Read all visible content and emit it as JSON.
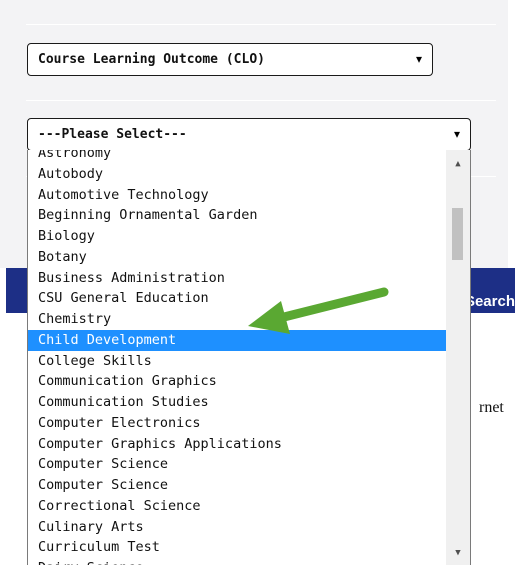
{
  "top_select": {
    "value": "Course Learning Outcome (CLO)"
  },
  "subject_select": {
    "value": "---Please Select---"
  },
  "search_button": {
    "label": "Search"
  },
  "partial_text": "rnet",
  "dropdown": {
    "selected": "Child Development",
    "options": [
      "Astronomy",
      "Autobody",
      "Automotive Technology",
      "Beginning Ornamental Garden",
      "Biology",
      "Botany",
      "Business Administration",
      "CSU General Education",
      "Chemistry",
      "Child Development",
      "College Skills",
      "Communication Graphics",
      "Communication Studies",
      "Computer Electronics",
      "Computer Graphics Applications",
      "Computer Science",
      "Computer Science",
      "Correctional Science",
      "Culinary Arts",
      "Curriculum Test",
      "Dairy Science"
    ]
  },
  "colors": {
    "highlight": "#1e90ff",
    "arrow": "#5aa832",
    "search_bar": "#1d2f86"
  }
}
